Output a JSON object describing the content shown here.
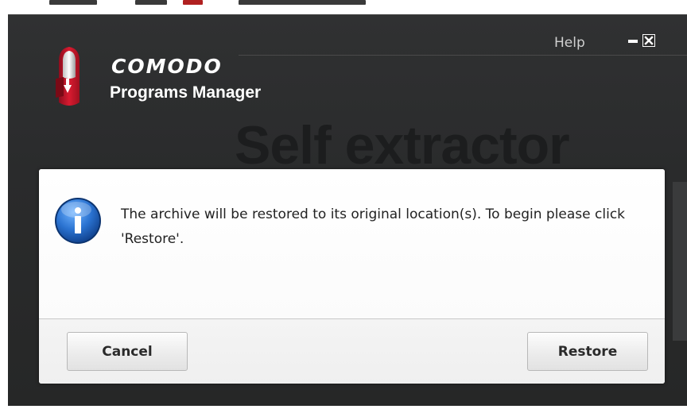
{
  "header": {
    "help_label": "Help",
    "brand_name": "COMODO",
    "product_name": "Programs Manager",
    "watermark_text": "Self extractor"
  },
  "window_controls": {
    "minimize_icon": "minimize-icon",
    "close_icon": "close-icon"
  },
  "dialog": {
    "icon": "info-icon",
    "message": "The archive will be restored to its original location(s). To begin please click 'Restore'.",
    "cancel_label": "Cancel",
    "restore_label": "Restore"
  },
  "colors": {
    "window_bg": "#2a2b2c",
    "dialog_bg": "#ffffff",
    "footer_bg": "#f0f0f0",
    "logo_red": "#c8102e",
    "info_blue": "#1f5fb0"
  }
}
